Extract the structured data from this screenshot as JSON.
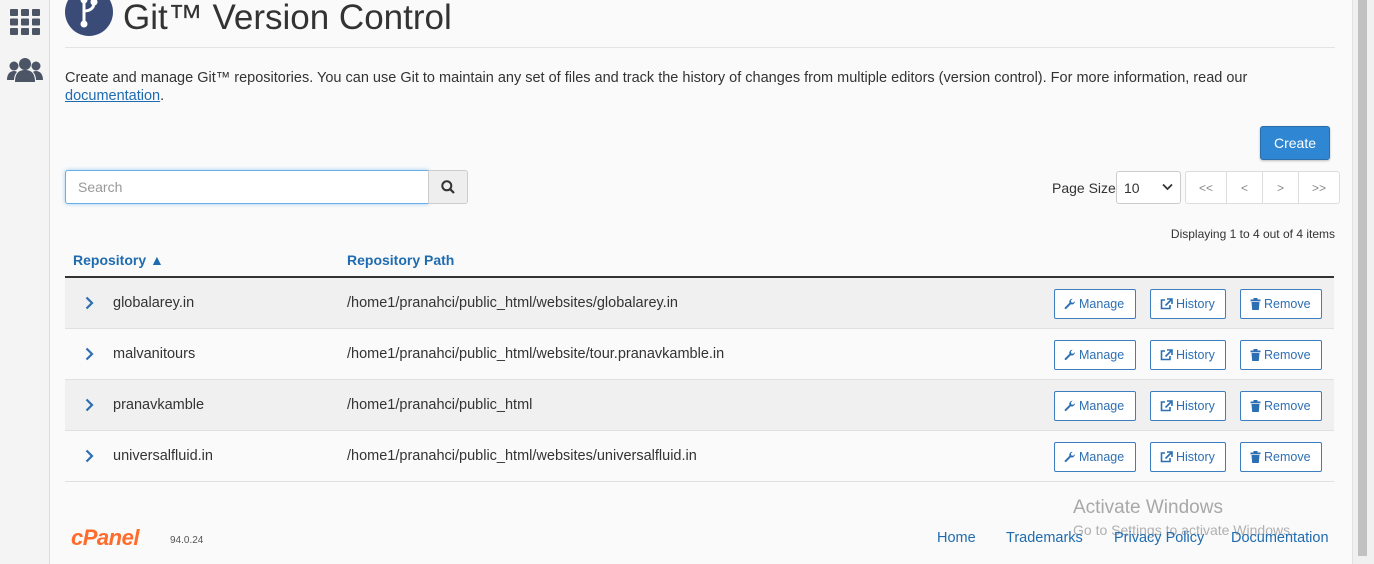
{
  "sidebar": {
    "items": [
      {
        "icon": "grid-icon"
      },
      {
        "icon": "users-icon"
      }
    ]
  },
  "header": {
    "title": "Git™ Version Control"
  },
  "description": {
    "text": "Create and manage Git™ repositories. You can use Git to maintain any set of files and track the history of changes from multiple editors (version control). For more information, read our ",
    "link": "documentation",
    "suffix": "."
  },
  "toolbar": {
    "create_label": "Create",
    "search_placeholder": "Search",
    "page_size_label": "Page Size",
    "page_size_value": "10",
    "pager": [
      "<<",
      "<",
      ">",
      ">>"
    ],
    "displaying": "Displaying 1 to 4 out of 4 items"
  },
  "table": {
    "columns": [
      "Repository ▲",
      "Repository Path"
    ],
    "actions": {
      "manage": "Manage",
      "history": "History",
      "remove": "Remove"
    },
    "rows": [
      {
        "name": "globalarey.in",
        "path": "/home1/pranahci/public_html/websites/globalarey.in"
      },
      {
        "name": "malvanitours",
        "path": "/home1/pranahci/public_html/website/tour.pranavkamble.in"
      },
      {
        "name": "pranavkamble",
        "path": "/home1/pranahci/public_html"
      },
      {
        "name": "universalfluid.in",
        "path": "/home1/pranahci/public_html/websites/universalfluid.in"
      }
    ]
  },
  "footer": {
    "brand": "cPanel",
    "version": "94.0.24",
    "links": [
      "Home",
      "Trademarks",
      "Privacy Policy",
      "Documentation"
    ]
  },
  "watermark": {
    "line1": "Activate Windows",
    "line2": "Go to Settings to activate Windows."
  },
  "colors": {
    "accent": "#2f86d2",
    "link": "#1f6bb0",
    "brand": "#ff6c2c"
  }
}
